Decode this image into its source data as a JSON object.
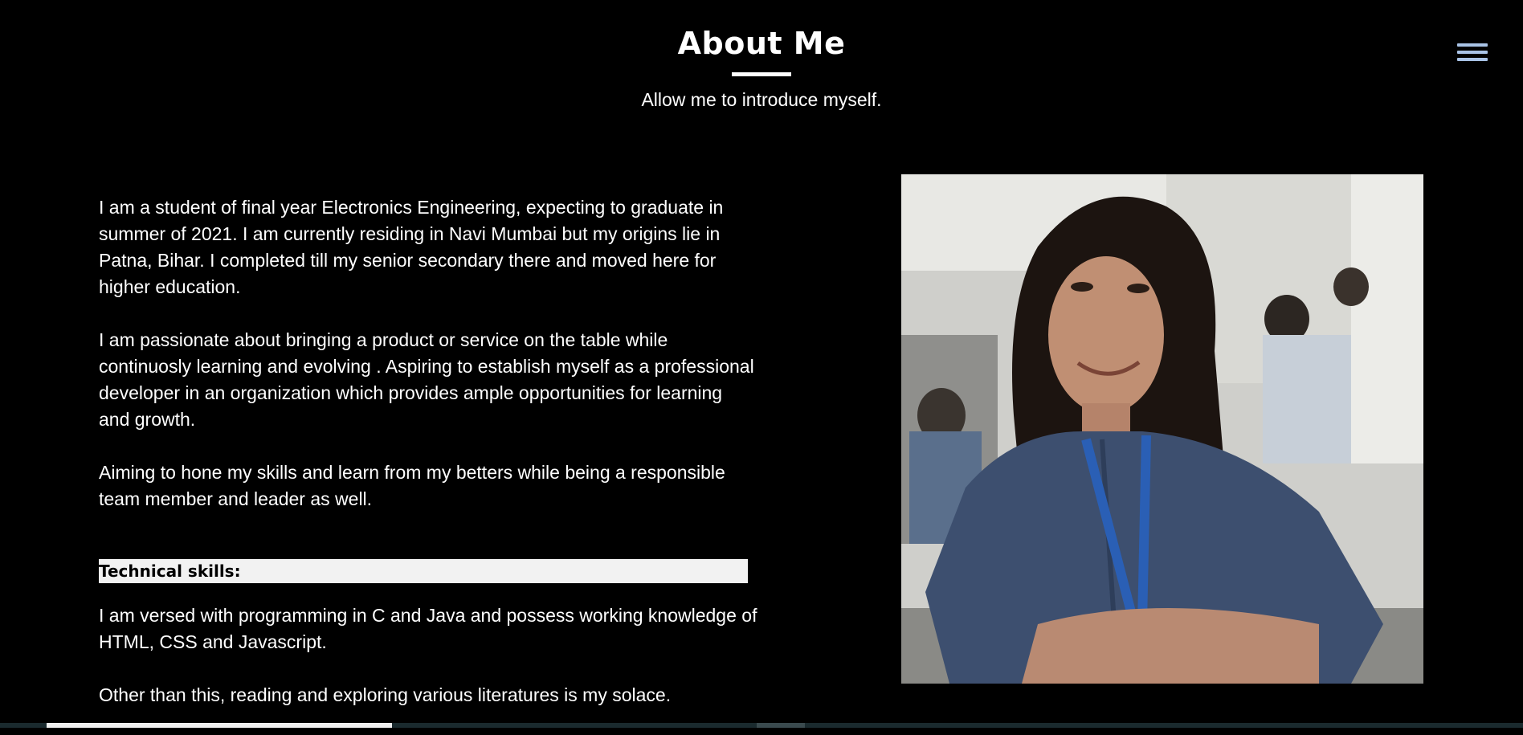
{
  "header": {
    "title": "About Me",
    "subtitle": "Allow me to introduce myself."
  },
  "menu": {
    "icon": "hamburger-menu-icon",
    "color": "#a9c3e6"
  },
  "about": {
    "paragraphs": [
      "I am a student of final year Electronics Engineering, expecting to graduate in summer of 2021. I am currently residing in Navi Mumbai but my origins lie in Patna, Bihar. I completed till my senior secondary there and moved here for higher education.",
      "I am passionate about bringing a product or service on the table while continuosly learning and evolving . Aspiring to establish myself as a professional developer in an organization which provides ample opportunities for learning and growth.",
      "Aiming to hone my skills and learn from my betters while being a responsible team member and leader as well."
    ]
  },
  "skills": {
    "heading": "Technical skills:",
    "paragraphs": [
      "I am versed with programming in C and Java and possess working knowledge of HTML, CSS and Javascript.",
      "Other than this, reading and exploring various literatures is my solace."
    ]
  }
}
